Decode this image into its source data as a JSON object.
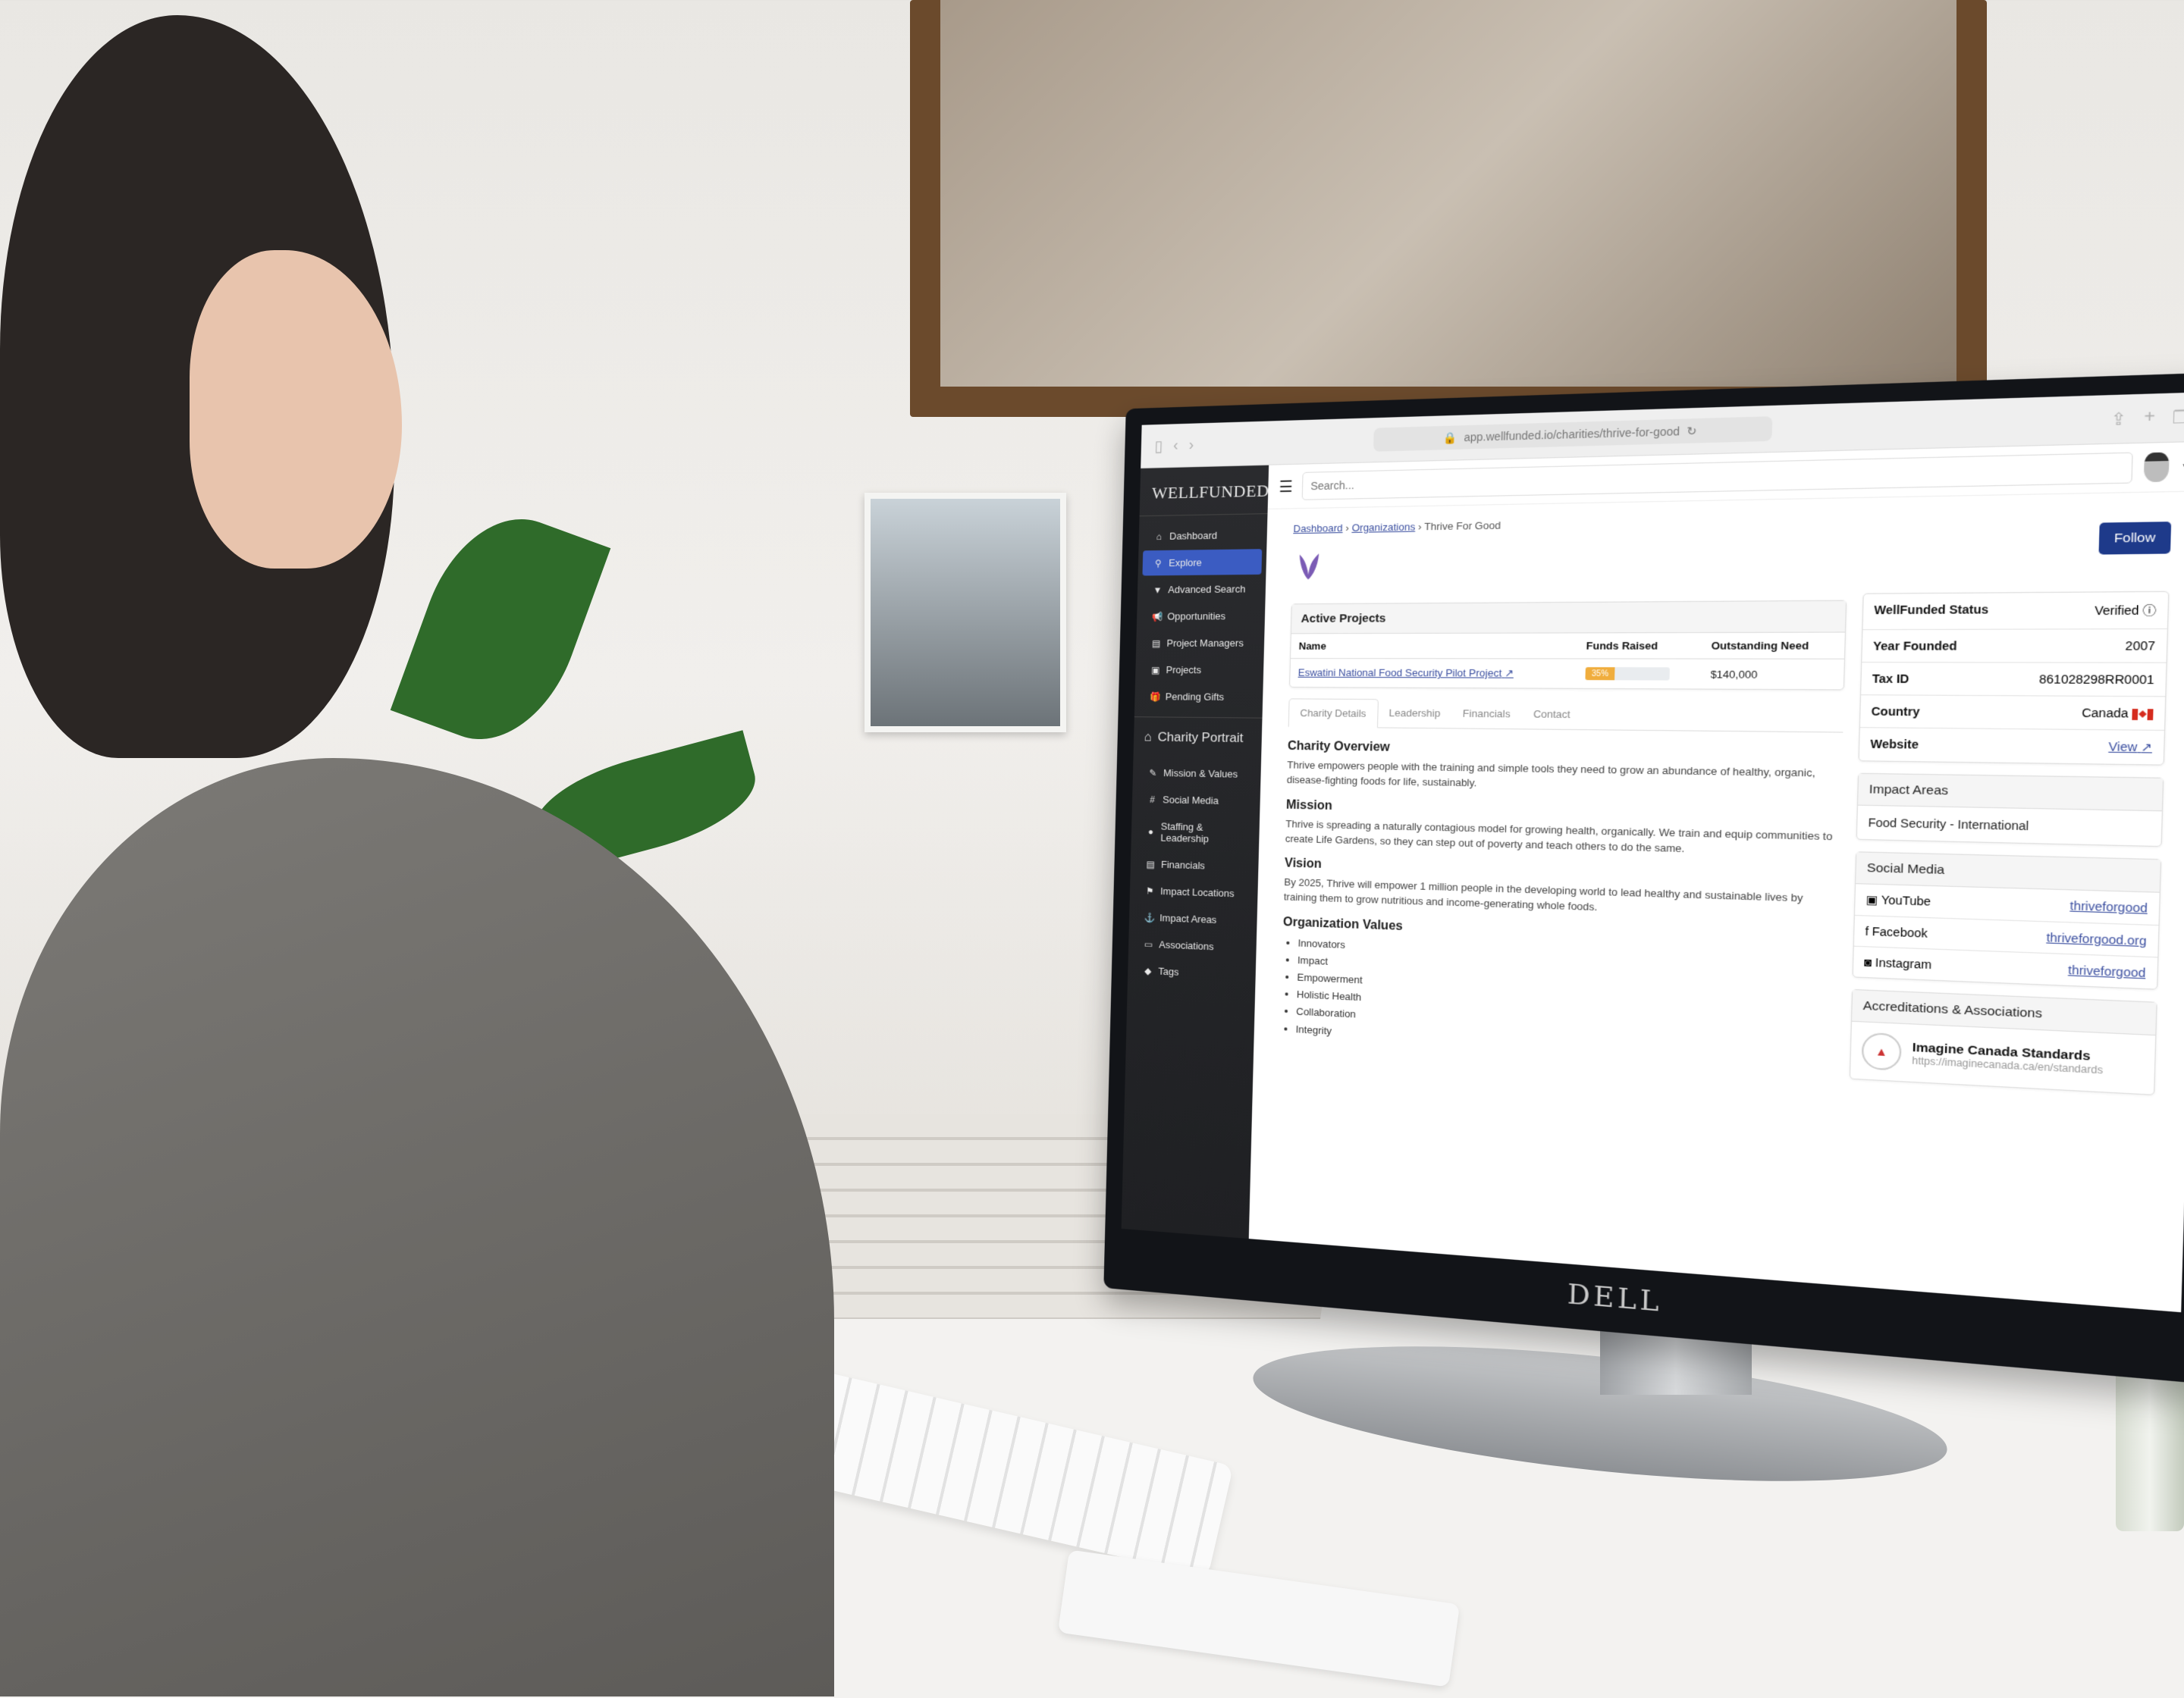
{
  "browser": {
    "url": "app.wellfunded.io/charities/thrive-for-good"
  },
  "monitor": {
    "brand": "DELL"
  },
  "app": {
    "brand": "WELLFUNDED",
    "search_placeholder": "Search..."
  },
  "sidebar": {
    "items": [
      {
        "label": "Dashboard",
        "icon": "home-icon",
        "glyph": "⌂",
        "active": false
      },
      {
        "label": "Explore",
        "icon": "search-icon",
        "glyph": "⚲",
        "active": true
      },
      {
        "label": "Advanced Search",
        "icon": "filter-icon",
        "glyph": "▼",
        "active": false
      },
      {
        "label": "Opportunities",
        "icon": "megaphone-icon",
        "glyph": "📢",
        "active": false
      },
      {
        "label": "Project Managers",
        "icon": "id-card-icon",
        "glyph": "▤",
        "active": false
      },
      {
        "label": "Projects",
        "icon": "projects-icon",
        "glyph": "▣",
        "active": false
      },
      {
        "label": "Pending Gifts",
        "icon": "gift-icon",
        "glyph": "🎁",
        "active": false
      }
    ],
    "portrait_title": "Charity Portrait",
    "portrait_items": [
      {
        "label": "Mission & Values",
        "icon": "edit-icon",
        "glyph": "✎"
      },
      {
        "label": "Social Media",
        "icon": "hashtag-icon",
        "glyph": "#"
      },
      {
        "label": "Staffing & Leadership",
        "icon": "user-icon",
        "glyph": "●"
      },
      {
        "label": "Financials",
        "icon": "ledger-icon",
        "glyph": "▤"
      },
      {
        "label": "Impact Locations",
        "icon": "map-pin-icon",
        "glyph": "⚑"
      },
      {
        "label": "Impact Areas",
        "icon": "anchor-icon",
        "glyph": "⚓"
      },
      {
        "label": "Associations",
        "icon": "laptop-icon",
        "glyph": "▭"
      },
      {
        "label": "Tags",
        "icon": "tag-icon",
        "glyph": "◆"
      }
    ]
  },
  "breadcrumb": {
    "items": [
      "Dashboard",
      "Organizations"
    ],
    "current": "Thrive For Good",
    "separator": "›"
  },
  "follow_label": "Follow",
  "active_projects": {
    "title": "Active Projects",
    "columns": [
      "Name",
      "Funds Raised",
      "Outstanding Need"
    ],
    "rows": [
      {
        "name": "Eswatini National Food Security Pilot Project",
        "funds_raised_pct": 35,
        "funds_raised_label": "35%",
        "outstanding_need": "$140,000"
      }
    ]
  },
  "tabs": [
    "Charity Details",
    "Leadership",
    "Financials",
    "Contact"
  ],
  "active_tab": "Charity Details",
  "details": {
    "overview_title": "Charity Overview",
    "overview": "Thrive empowers people with the training and simple tools they need to grow an abundance of healthy, organic, disease-fighting foods for life, sustainably.",
    "mission_title": "Mission",
    "mission": "Thrive is spreading a naturally contagious model for growing health, organically. We train and equip communities to create Life Gardens, so they can step out of poverty and teach others to do the same.",
    "vision_title": "Vision",
    "vision": "By 2025, Thrive will empower 1 million people in the developing world to lead healthy and sustainable lives by training them to grow nutritious and income-generating whole foods.",
    "values_title": "Organization Values",
    "values": [
      "Innovators",
      "Impact",
      "Empowerment",
      "Holistic Health",
      "Collaboration",
      "Integrity"
    ]
  },
  "info": {
    "status_label": "WellFunded Status",
    "status_value": "Verified",
    "year_label": "Year Founded",
    "year_value": "2007",
    "tax_label": "Tax ID",
    "tax_value": "861028298RR0001",
    "country_label": "Country",
    "country_value": "Canada",
    "website_label": "Website",
    "website_value": "View"
  },
  "impact_areas": {
    "title": "Impact Areas",
    "items": [
      "Food Security - International"
    ]
  },
  "social_media": {
    "title": "Social Media",
    "items": [
      {
        "platform": "YouTube",
        "handle": "thriveforgood",
        "icon": "youtube-icon"
      },
      {
        "platform": "Facebook",
        "handle": "thriveforgood.org",
        "icon": "facebook-icon"
      },
      {
        "platform": "Instagram",
        "handle": "thriveforgood",
        "icon": "instagram-icon"
      }
    ]
  },
  "accreditations": {
    "title": "Accreditations & Associations",
    "items": [
      {
        "name": "Imagine Canada Standards",
        "url": "https://imaginecanada.ca/en/standards"
      }
    ]
  }
}
